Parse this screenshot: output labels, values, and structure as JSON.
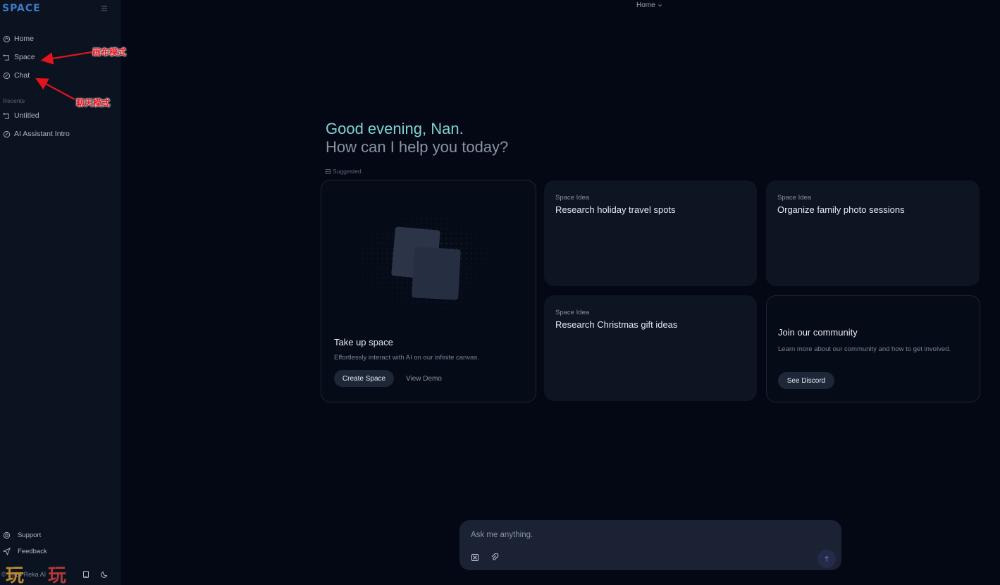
{
  "sidebar": {
    "logo": "SPACE",
    "nav": [
      {
        "label": "Home",
        "icon": "home-icon"
      },
      {
        "label": "Space",
        "icon": "canvas-icon"
      },
      {
        "label": "Chat",
        "icon": "chat-icon"
      }
    ],
    "recents_label": "Recents",
    "recents": [
      {
        "label": "Untitled",
        "icon": "canvas-icon"
      },
      {
        "label": "AI Assistant Intro",
        "icon": "chat-icon"
      }
    ],
    "footer": [
      {
        "label": "Support",
        "icon": "support-icon"
      },
      {
        "label": "Feedback",
        "icon": "send-icon"
      }
    ],
    "copyright": "© 2024 Reka AI",
    "watermark": [
      "玩",
      "玩"
    ]
  },
  "annotations": {
    "space_label": "画布模式",
    "chat_label": "聊天模式"
  },
  "header": {
    "location": "Home"
  },
  "main": {
    "greeting": "Good evening, Nan.",
    "prompt": "How can I help you today?",
    "suggested_label": "Suggested",
    "hero_card": {
      "title": "Take up space",
      "description": "Effortlessly interact with AI on our infinite canvas.",
      "primary_button": "Create Space",
      "secondary_button": "View Demo"
    },
    "ideas": [
      {
        "kicker": "Space Idea",
        "title": "Research holiday travel spots"
      },
      {
        "kicker": "Space Idea",
        "title": "Organize family photo sessions"
      },
      {
        "kicker": "Space Idea",
        "title": "Research Christmas gift ideas"
      }
    ],
    "community_card": {
      "title": "Join our community",
      "description": "Learn more about our community and how to get involved.",
      "button": "See Discord"
    }
  },
  "chat": {
    "placeholder": "Ask me anything."
  },
  "colors": {
    "background": "#030814",
    "sidebar": "#0b1220",
    "card": "#0d1422",
    "greeting": "#7fd3d6",
    "logo": "#3e78c8",
    "annotation": "#e4141c"
  }
}
